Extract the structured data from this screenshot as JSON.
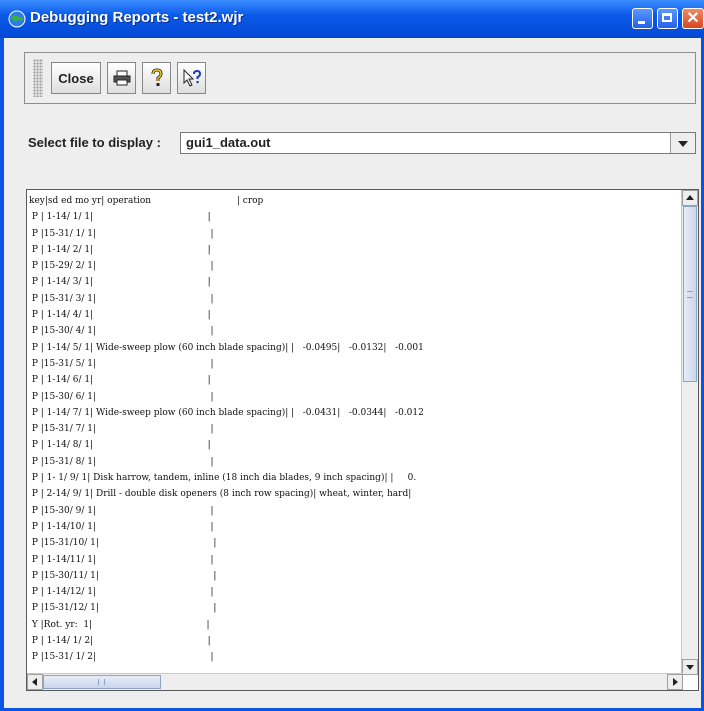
{
  "window": {
    "title": "Debugging Reports - test2.wjr",
    "icon": "app-globe-icon"
  },
  "toolbar": {
    "close_label": "Close",
    "print_icon": "printer-icon",
    "help_icon": "question-mark-icon",
    "context_help_icon": "arrow-question-icon"
  },
  "file_selector": {
    "label": "Select file to display :",
    "value": "gui1_data.out"
  },
  "report": {
    "lines": [
      "key|sd ed mo yr| operation                              | crop",
      " P | 1-14/ 1/ 1|                                        |",
      " P |15-31/ 1/ 1|                                        |",
      " P | 1-14/ 2/ 1|                                        |",
      " P |15-29/ 2/ 1|                                        |",
      " P | 1-14/ 3/ 1|                                        |",
      " P |15-31/ 3/ 1|                                        |",
      " P | 1-14/ 4/ 1|                                        |",
      " P |15-30/ 4/ 1|                                        |",
      " P | 1-14/ 5/ 1| Wide-sweep plow (60 inch blade spacing)| |   -0.0495|   -0.0132|   -0.001",
      " P |15-31/ 5/ 1|                                        |",
      " P | 1-14/ 6/ 1|                                        |",
      " P |15-30/ 6/ 1|                                        |",
      " P | 1-14/ 7/ 1| Wide-sweep plow (60 inch blade spacing)| |   -0.0431|   -0.0344|   -0.012",
      " P |15-31/ 7/ 1|                                        |",
      " P | 1-14/ 8/ 1|                                        |",
      " P |15-31/ 8/ 1|                                        |",
      " P | 1- 1/ 9/ 1| Disk harrow, tandem, inline (18 inch dia blades, 9 inch spacing)| |     0.",
      " P | 2-14/ 9/ 1| Drill - double disk openers (8 inch row spacing)| wheat, winter, hard|",
      " P |15-30/ 9/ 1|                                        |",
      " P | 1-14/10/ 1|                                        |",
      " P |15-31/10/ 1|                                        |",
      " P | 1-14/11/ 1|                                        |",
      " P |15-30/11/ 1|                                        |",
      " P | 1-14/12/ 1|                                        |",
      " P |15-31/12/ 1|                                        |",
      " Y |Rot. yr:  1|                                        |",
      " P | 1-14/ 1/ 2|                                        |",
      " P |15-31/ 1/ 2|                                        |"
    ]
  }
}
